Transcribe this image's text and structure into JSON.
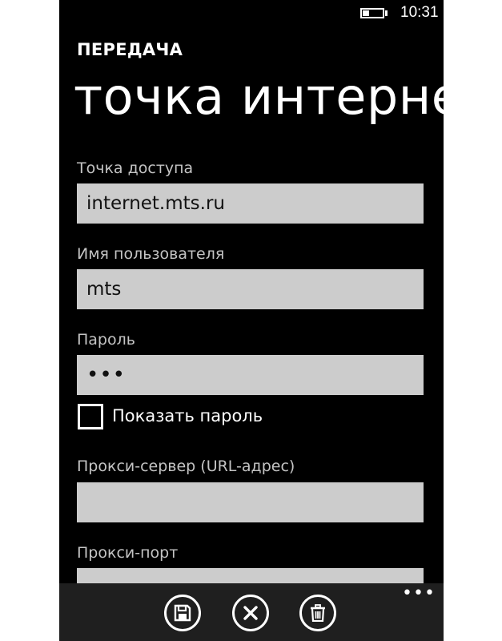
{
  "status_bar": {
    "time": "10:31",
    "battery_level": 0.35
  },
  "app_title": "ПЕРЕДАЧА",
  "page_title": "точка интернет",
  "fields": {
    "access_point": {
      "label": "Точка доступа",
      "value": "internet.mts.ru"
    },
    "username": {
      "label": "Имя пользователя",
      "value": "mts"
    },
    "password": {
      "label": "Пароль",
      "value": "•••"
    },
    "proxy_server": {
      "label": "Прокси-сервер (URL-адрес)",
      "value": ""
    },
    "proxy_port": {
      "label": "Прокси-порт",
      "value": ""
    }
  },
  "show_password": {
    "label": "Показать пароль",
    "checked": false
  },
  "app_bar": {
    "more_label": "•••",
    "buttons": [
      {
        "name": "save",
        "icon": "save-icon"
      },
      {
        "name": "cancel",
        "icon": "close-icon"
      },
      {
        "name": "delete",
        "icon": "trash-icon"
      }
    ]
  },
  "colors": {
    "background": "#000000",
    "field_background": "#cccccc",
    "app_bar_background": "#1f1f1f",
    "label": "#c4c4c4"
  }
}
